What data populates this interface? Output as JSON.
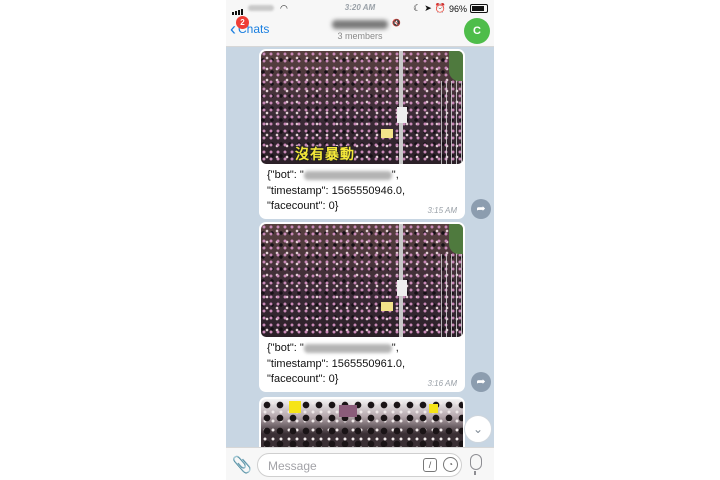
{
  "status_bar": {
    "time": "3:20 AM",
    "battery": "96%"
  },
  "nav": {
    "back_label": "Chats",
    "badge_count": "2",
    "subtitle": "3 members",
    "avatar_letter": "C"
  },
  "messages": [
    {
      "image_caption": "沒有暴動",
      "text_open": "{\"bot\": \"",
      "text_close": "\",",
      "timestamp_line": "\"timestamp\": 1565550946.0,",
      "facecount_line": "\"facecount\": 0}",
      "time": "3:15 AM"
    },
    {
      "image_caption": "",
      "text_open": "{\"bot\": \"",
      "text_close": "\",",
      "timestamp_line": "\"timestamp\": 1565550961.0,",
      "facecount_line": "\"facecount\": 0}",
      "time": "3:16 AM"
    }
  ],
  "composer": {
    "placeholder": "Message",
    "value": ""
  },
  "icons": {
    "back": "chevron-left-icon",
    "attach": "paperclip-icon",
    "command": "slash-command-icon",
    "sticker": "sticker-icon",
    "mic": "microphone-icon",
    "share": "share-arrow-icon",
    "scroll": "chevron-down-icon"
  },
  "colors": {
    "accent": "#1a7fe0",
    "badge": "#ef3e36",
    "avatar": "#4ebd4a",
    "chat_background": "#c8d6e3",
    "caption_yellow": "#f5e93a"
  }
}
